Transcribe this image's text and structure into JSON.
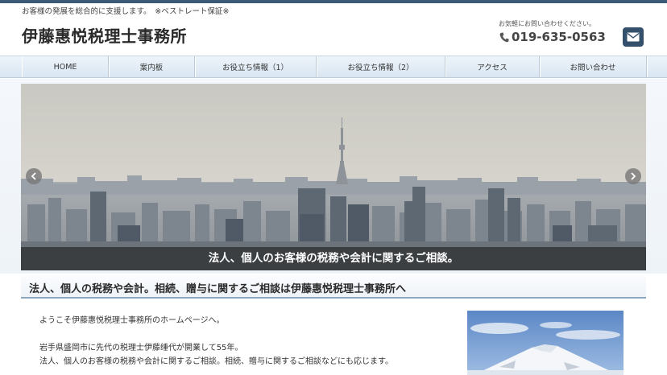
{
  "header": {
    "tagline": "お客様の発展を総合的に支援します。　※ベストレート保証※",
    "site_title": "伊藤惠悦税理士事務所",
    "contact_note": "お気軽にお問い合わせください。",
    "phone": "019-635-0563",
    "phone_icon": "phone-icon",
    "mail_icon": "mail-icon"
  },
  "nav": {
    "items": [
      {
        "label": "HOME"
      },
      {
        "label": "案内板"
      },
      {
        "label": "お役立ち情報（1）"
      },
      {
        "label": "お役立ち情報（2）"
      },
      {
        "label": "アクセス"
      },
      {
        "label": "お問い合わせ"
      }
    ]
  },
  "slider": {
    "caption": "法人、個人のお客様の税務や会計に関するご相談。",
    "prev_icon": "chevron-left-icon",
    "next_icon": "chevron-right-icon"
  },
  "main": {
    "heading": "法人、個人の税務や会計。相続、贈与に関するご相談は伊藤惠悦税理士事務所へ",
    "paragraphs": [
      "ようこそ伊藤惠悦税理士事務所のホームページへ。",
      "岩手県盛岡市に先代の税理士伊藤缍代が開業して55年。",
      "法人、個人のお客様の税務や会計に関するご相談。相続、贈与に関するご相談などにも応じます。"
    ]
  },
  "colors": {
    "topbar": "#3c5a76",
    "mail_button": "#34506b",
    "heading_rule": "#8ea7c0"
  }
}
